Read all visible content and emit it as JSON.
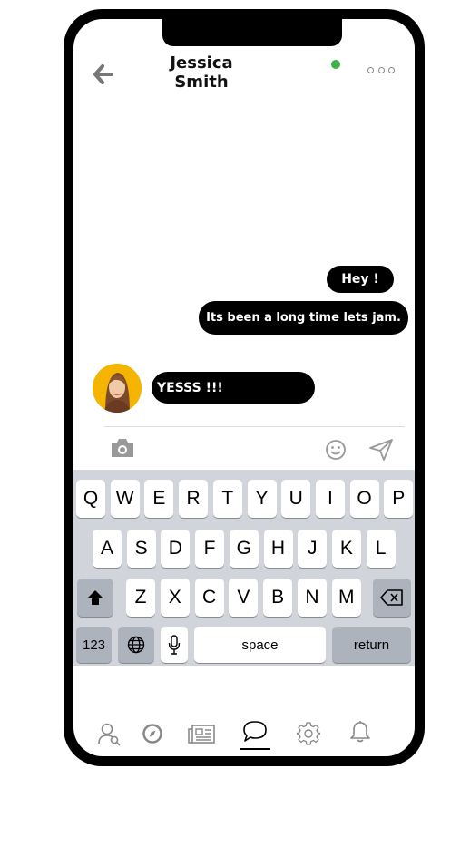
{
  "header": {
    "contact_name": "Jessica Smith",
    "status": "online",
    "status_color": "#3fb04b"
  },
  "messages": [
    {
      "side": "sent",
      "text": "Hey !"
    },
    {
      "side": "sent",
      "text": "Its been a long time lets jam."
    },
    {
      "side": "received",
      "text": "YESSS !!!"
    }
  ],
  "composer": {
    "icons": [
      "camera-icon",
      "emoji-icon",
      "send-icon"
    ]
  },
  "keyboard": {
    "row1": [
      "Q",
      "W",
      "E",
      "R",
      "T",
      "Y",
      "U",
      "I",
      "O",
      "P"
    ],
    "row2": [
      "A",
      "S",
      "D",
      "F",
      "G",
      "H",
      "J",
      "K",
      "L"
    ],
    "row3": [
      "Z",
      "X",
      "C",
      "V",
      "B",
      "N",
      "M"
    ],
    "numbers_label": "123",
    "space_label": "space",
    "return_label": "return"
  },
  "tabbar": {
    "items": [
      "contacts-icon",
      "explore-icon",
      "news-icon",
      "chat-icon",
      "settings-icon",
      "notifications-icon"
    ],
    "active": "chat-icon"
  }
}
